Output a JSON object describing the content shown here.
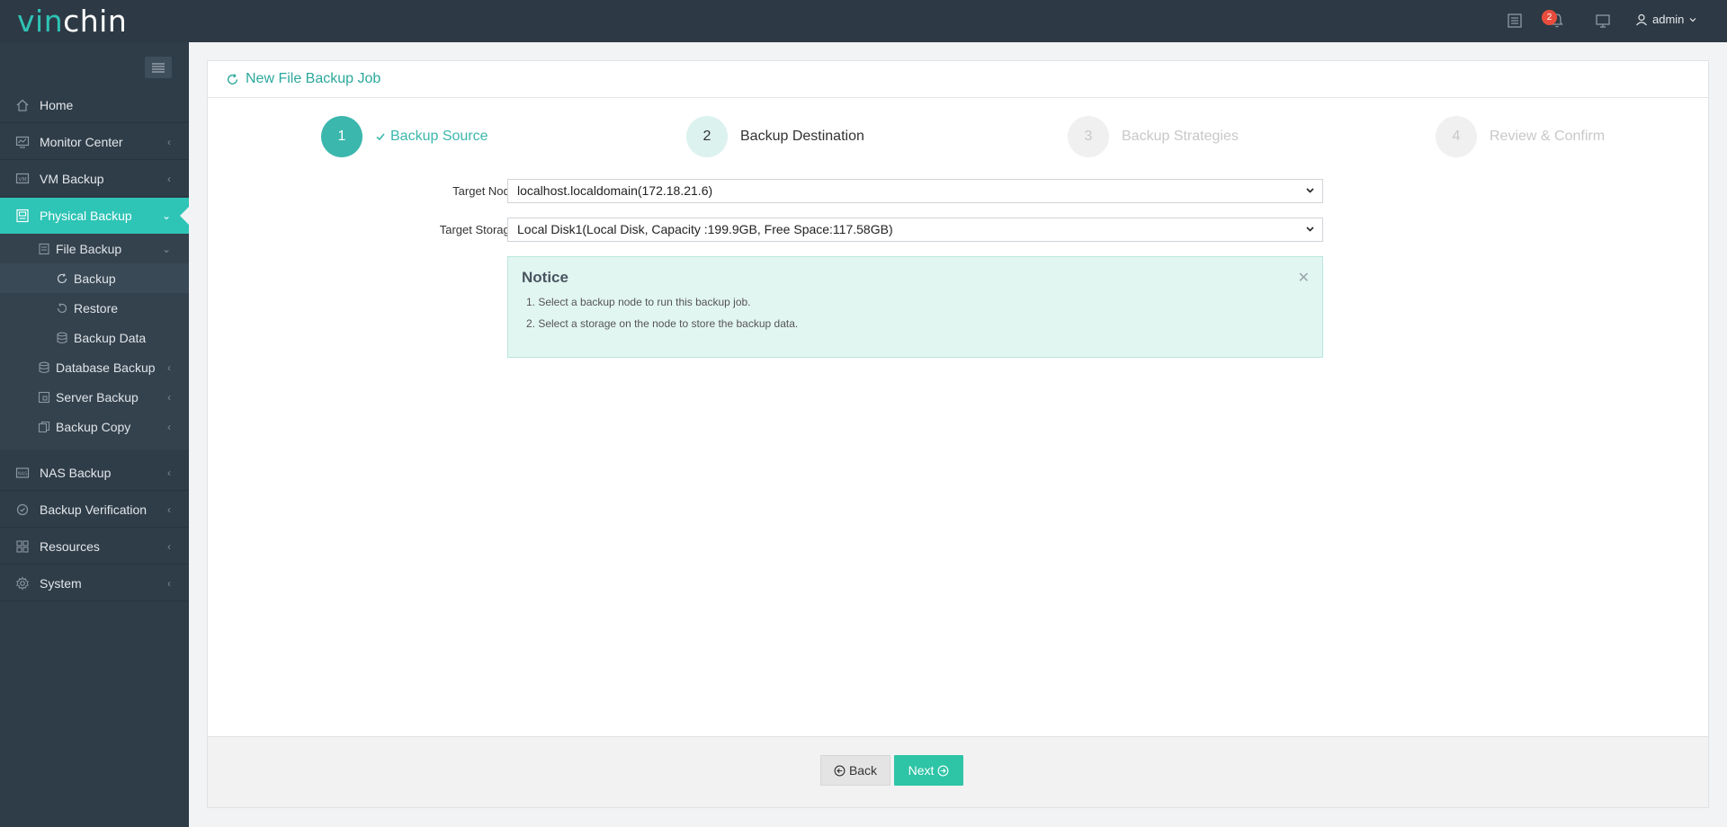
{
  "header": {
    "logo_part1": "vin",
    "logo_part2": "chin",
    "notification_count": "2",
    "user": "admin",
    "icons": [
      "list-icon",
      "bell-icon",
      "monitor-icon",
      "user-icon"
    ]
  },
  "sidebar": {
    "items": [
      {
        "label": "Home",
        "icon": "home-icon"
      },
      {
        "label": "Monitor Center",
        "icon": "monitor-center-icon"
      },
      {
        "label": "VM Backup",
        "icon": "vm-icon"
      },
      {
        "label": "Physical Backup",
        "icon": "physical-backup-icon"
      },
      {
        "label": "NAS Backup",
        "icon": "nas-icon"
      },
      {
        "label": "Backup Verification",
        "icon": "verification-icon"
      },
      {
        "label": "Resources",
        "icon": "resources-icon"
      },
      {
        "label": "System",
        "icon": "gear-icon"
      }
    ],
    "sub_items": [
      {
        "label": "File Backup"
      },
      {
        "label": "Backup"
      },
      {
        "label": "Restore"
      },
      {
        "label": "Backup Data"
      },
      {
        "label": "Database Backup"
      },
      {
        "label": "Server Backup"
      },
      {
        "label": "Backup Copy"
      }
    ]
  },
  "panel": {
    "title": "New File Backup Job"
  },
  "steps": [
    {
      "num": "1",
      "label": "Backup Source"
    },
    {
      "num": "2",
      "label": "Backup Destination"
    },
    {
      "num": "3",
      "label": "Backup Strategies"
    },
    {
      "num": "4",
      "label": "Review & Confirm"
    }
  ],
  "form": {
    "target_node_label": "Target Node",
    "target_node_value": "localhost.localdomain(172.18.21.6)",
    "target_storage_label": "Target Storage",
    "target_storage_value": "Local Disk1(Local Disk, Capacity :199.9GB, Free Space:117.58GB)"
  },
  "notice": {
    "title": "Notice",
    "lines": [
      "1. Select a backup node to run this backup job.",
      "2. Select a storage on the node to store the backup data."
    ]
  },
  "buttons": {
    "back": "Back",
    "next": "Next"
  },
  "colors": {
    "accent": "#2ec4b6",
    "topbar": "#2d3a45",
    "sidebar": "#2f3d49",
    "notice_bg": "#e2f6f1"
  }
}
